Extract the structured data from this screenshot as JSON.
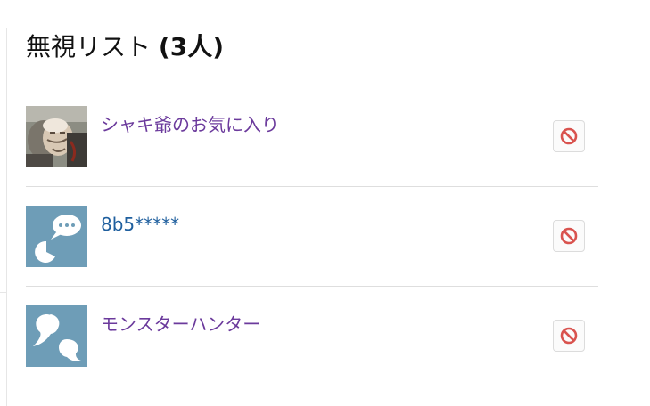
{
  "header": {
    "title_prefix": "無視リスト",
    "title_count": "(3人)"
  },
  "ignore_list": [
    {
      "name": "シャキ爺のお気に入り",
      "avatar": "photo",
      "link_color": "#6b3a9c",
      "action_icon": "block-icon"
    },
    {
      "name": "8b5*****",
      "avatar": "speech-bubble-icon",
      "link_color": "#1f5f9e",
      "action_icon": "block-icon"
    },
    {
      "name": "モンスターハンター",
      "avatar": "speech-bubbles-icon",
      "link_color": "#6b3a9c",
      "action_icon": "block-icon"
    }
  ],
  "colors": {
    "avatar_bg": "#6e9db7",
    "block_red": "#d9534f"
  }
}
